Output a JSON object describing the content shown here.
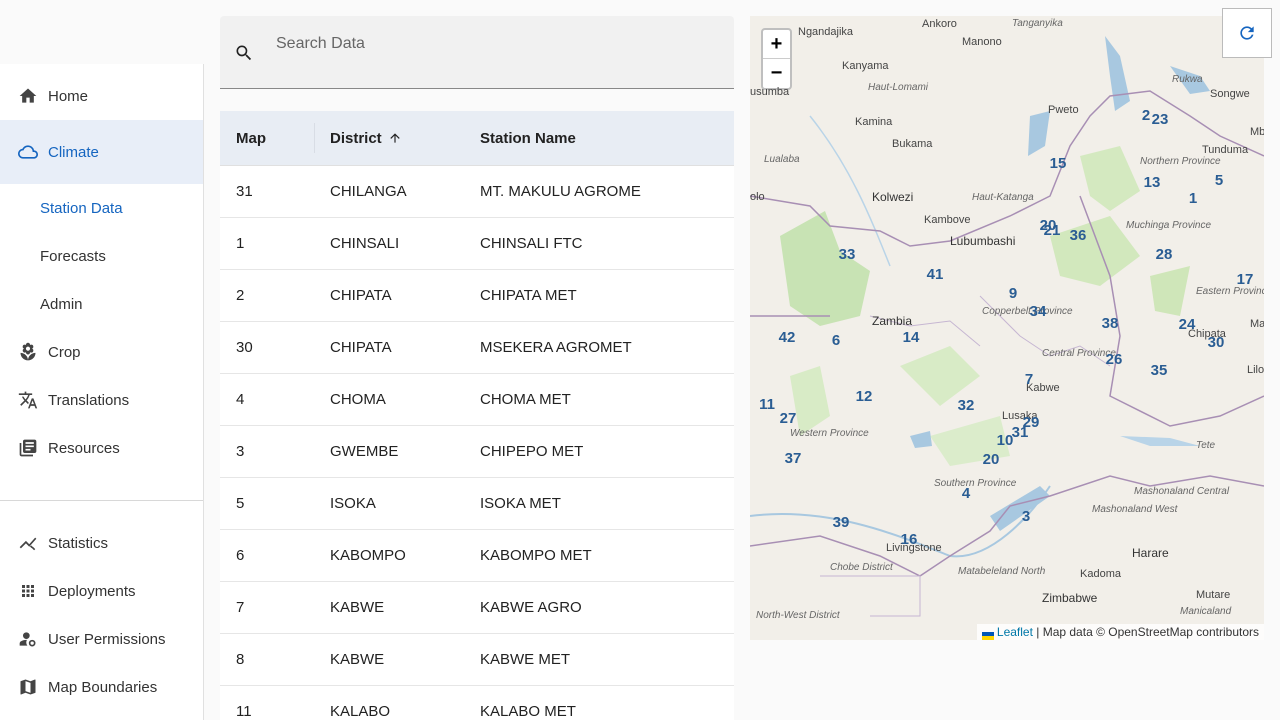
{
  "sidebar": {
    "home": "Home",
    "climate": "Climate",
    "climate_sub": [
      "Station Data",
      "Forecasts",
      "Admin"
    ],
    "crop": "Crop",
    "translations": "Translations",
    "resources": "Resources",
    "statistics": "Statistics",
    "deployments": "Deployments",
    "user_permissions": "User Permissions",
    "map_boundaries": "Map Boundaries"
  },
  "search": {
    "placeholder": "Search Data"
  },
  "table": {
    "headers": {
      "map": "Map",
      "district": "District",
      "station": "Station Name"
    },
    "rows": [
      {
        "map": "31",
        "district": "CHILANGA",
        "station": "MT. MAKULU AGROME"
      },
      {
        "map": "1",
        "district": "CHINSALI",
        "station": "CHINSALI FTC"
      },
      {
        "map": "2",
        "district": "CHIPATA",
        "station": "CHIPATA MET"
      },
      {
        "map": "30",
        "district": "CHIPATA",
        "station": "MSEKERA AGROMET"
      },
      {
        "map": "4",
        "district": "CHOMA",
        "station": "CHOMA MET"
      },
      {
        "map": "3",
        "district": "GWEMBE",
        "station": "CHIPEPO MET"
      },
      {
        "map": "5",
        "district": "ISOKA",
        "station": "ISOKA MET"
      },
      {
        "map": "6",
        "district": "KABOMPO",
        "station": "KABOMPO MET"
      },
      {
        "map": "7",
        "district": "KABWE",
        "station": "KABWE AGRO"
      },
      {
        "map": "8",
        "district": "KABWE",
        "station": "KABWE MET"
      },
      {
        "map": "11",
        "district": "KALABO",
        "station": "KALABO MET"
      }
    ]
  },
  "map": {
    "zoom_in": "+",
    "zoom_out": "−",
    "places": [
      "Ngandajika",
      "Ankoro",
      "Tanganyika",
      "Manono",
      "Kanyama",
      "usumba",
      "Haut-Lomami",
      "Pweto",
      "Rukwa",
      "Songwe",
      "Kamina",
      "Bukama",
      "Mbe",
      "Tunduma",
      "Lualaba",
      "Northern Province",
      "olo",
      "Kolwezi",
      "Haut-Katanga",
      "Kambove",
      "Lubumbashi",
      "Muchinga Province",
      "Zambia",
      "Copperbelt Province",
      "Eastern Province",
      "Chipata",
      "Ma",
      "Central Province",
      "Kabwe",
      "Lilo",
      "Western Province",
      "Lusaka",
      "Tete",
      "Southern Province",
      "Mashonaland West",
      "Mashonaland Central",
      "Livingstone",
      "Harare",
      "Chobe District",
      "Matabeleland North",
      "Kadoma",
      "Zimbabwe",
      "Mutare",
      "North-West District",
      "Manicaland"
    ],
    "markers": [
      "2",
      "23",
      "15",
      "13",
      "5",
      "1",
      "20",
      "21",
      "36",
      "28",
      "33",
      "41",
      "9",
      "34",
      "17",
      "42",
      "6",
      "14",
      "38",
      "24",
      "30",
      "26",
      "35",
      "7",
      "12",
      "11",
      "27",
      "32",
      "29",
      "31",
      "10",
      "37",
      "20",
      "4",
      "3",
      "39",
      "16"
    ],
    "attribution_link": "Leaflet",
    "attribution_text": " | Map data © OpenStreetMap contributors"
  },
  "colors": {
    "accent": "#1565c0",
    "active_bg": "#e8eef8",
    "marker": "#2a5d93"
  }
}
